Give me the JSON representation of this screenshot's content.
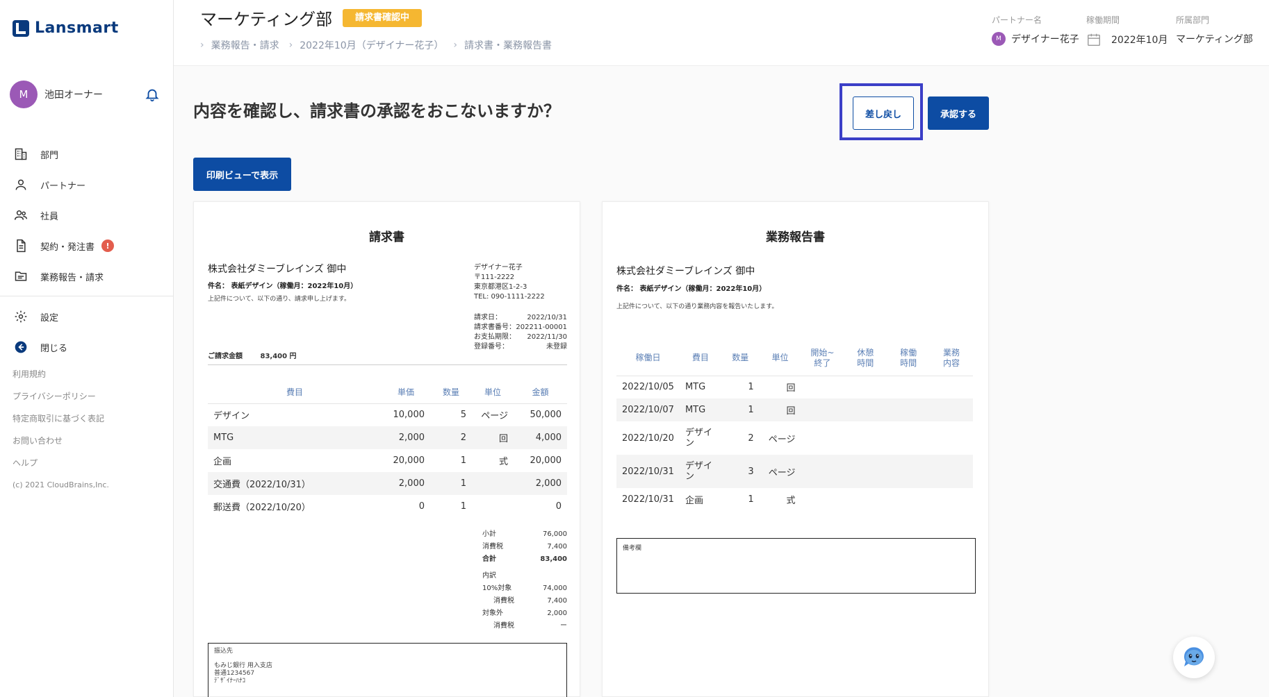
{
  "app": {
    "logo_text": "Lansmart"
  },
  "user": {
    "avatar_initial": "M",
    "name": "池田オーナー"
  },
  "nav": [
    {
      "label": "部門",
      "icon": "building-icon"
    },
    {
      "label": "パートナー",
      "icon": "person-icon"
    },
    {
      "label": "社員",
      "icon": "people-icon"
    },
    {
      "label": "契約・発注書",
      "icon": "document-icon",
      "badge": "!"
    },
    {
      "label": "業務報告・請求",
      "icon": "folder-icon"
    }
  ],
  "nav2": [
    {
      "label": "設定",
      "icon": "gear-icon"
    },
    {
      "label": "閉じる",
      "icon": "back-arrow-icon"
    }
  ],
  "footer": {
    "links": [
      "利用規約",
      "プライバシーポリシー",
      "特定商取引に基づく表記",
      "お問い合わせ",
      "ヘルプ"
    ],
    "copyright": "(c) 2021 CloudBrains,Inc."
  },
  "header": {
    "title": "マーケティング部",
    "status": "請求書確認中",
    "breadcrumb": [
      "業務報告・請求",
      "2022年10月（デザイナー花子）",
      "請求書・業務報告書"
    ],
    "partner_label": "パートナー名",
    "partner_initial": "M",
    "partner_name": "デザイナー花子",
    "period_label": "稼働期間",
    "period_value": "2022年10月",
    "dept_label": "所属部門",
    "dept_value": "マーケティング部"
  },
  "main": {
    "question": "内容を確認し、請求書の承認をおこないますか？",
    "return_label": "差し戻し",
    "approve_label": "承認する",
    "print_label": "印刷ビューで表示"
  },
  "invoice": {
    "title": "請求書",
    "recipient": "株式会社ダミーブレインズ 御中",
    "subject": "件名：   表紙デザイン（稼働月：2022年10月）",
    "note": "上記件について、以下の通り、請求申し上げます。",
    "issuer": [
      "デザイナー花子",
      "〒111-2222",
      "東京都港区1-2-3",
      "TEL: 090-1111-2222"
    ],
    "meta": [
      {
        "label": "請求日：",
        "value": "2022/10/31"
      },
      {
        "label": "請求書番号：",
        "value": "202211-00001"
      },
      {
        "label": "お支払期限：",
        "value": "2022/11/30"
      },
      {
        "label": "登録番号：",
        "value": "未登録"
      }
    ],
    "amount_label": "ご請求金額",
    "amount_value": "83,400 円",
    "columns": [
      "費目",
      "単価",
      "数量",
      "単位",
      "金額"
    ],
    "rows": [
      [
        "デザイン",
        "10,000",
        "5",
        "ページ",
        "50,000"
      ],
      [
        "MTG",
        "2,000",
        "2",
        "回",
        "4,000"
      ],
      [
        "企画",
        "20,000",
        "1",
        "式",
        "20,000"
      ],
      [
        "交通費（2022/10/31）",
        "2,000",
        "1",
        "",
        "2,000"
      ],
      [
        "郵送費（2022/10/20）",
        "0",
        "1",
        "",
        "0"
      ]
    ],
    "totals": [
      {
        "label": "小計",
        "value": "76,000",
        "bold": false
      },
      {
        "label": "消費税",
        "value": "7,400",
        "bold": false
      },
      {
        "label": "合計",
        "value": "83,400",
        "bold": true
      }
    ],
    "breakdown_title": "内訳",
    "breakdown": [
      {
        "label": "10%対象",
        "value": "74,000"
      },
      {
        "label": "消費税",
        "value": "7,400"
      },
      {
        "label": "対象外",
        "value": "2,000"
      },
      {
        "label": "消費税",
        "value": "ー"
      }
    ],
    "bank_title": "振込先",
    "bank_lines": [
      "もみじ銀行 用入支店",
      "普通1234567",
      "ﾃﾞｻﾞｲﾅｰﾊﾅｺ"
    ]
  },
  "report": {
    "title": "業務報告書",
    "recipient": "株式会社ダミーブレインズ 御中",
    "subject": "件名：   表紙デザイン（稼働月：2022年10月）",
    "note": "上記件について、以下の通り業務内容を報告いたします。",
    "columns": [
      "稼働日",
      "費目",
      "数量",
      "単位",
      "開始~終了",
      "休憩時間",
      "稼働時間",
      "業務内容"
    ],
    "rows": [
      [
        "2022/10/05",
        "MTG",
        "1",
        "回",
        "",
        "",
        "",
        ""
      ],
      [
        "2022/10/07",
        "MTG",
        "1",
        "回",
        "",
        "",
        "",
        ""
      ],
      [
        "2022/10/20",
        "デザイン",
        "2",
        "ページ",
        "",
        "",
        "",
        ""
      ],
      [
        "2022/10/31",
        "デザイン",
        "3",
        "ページ",
        "",
        "",
        "",
        ""
      ],
      [
        "2022/10/31",
        "企画",
        "1",
        "式",
        "",
        "",
        "",
        ""
      ]
    ],
    "remarks_label": "備考欄"
  },
  "colors": {
    "primary": "#0d4ca3",
    "status": "#f5b731",
    "highlight": "#3b3fc7",
    "alert": "#e35d4d",
    "avatar": "#9b59b6"
  }
}
